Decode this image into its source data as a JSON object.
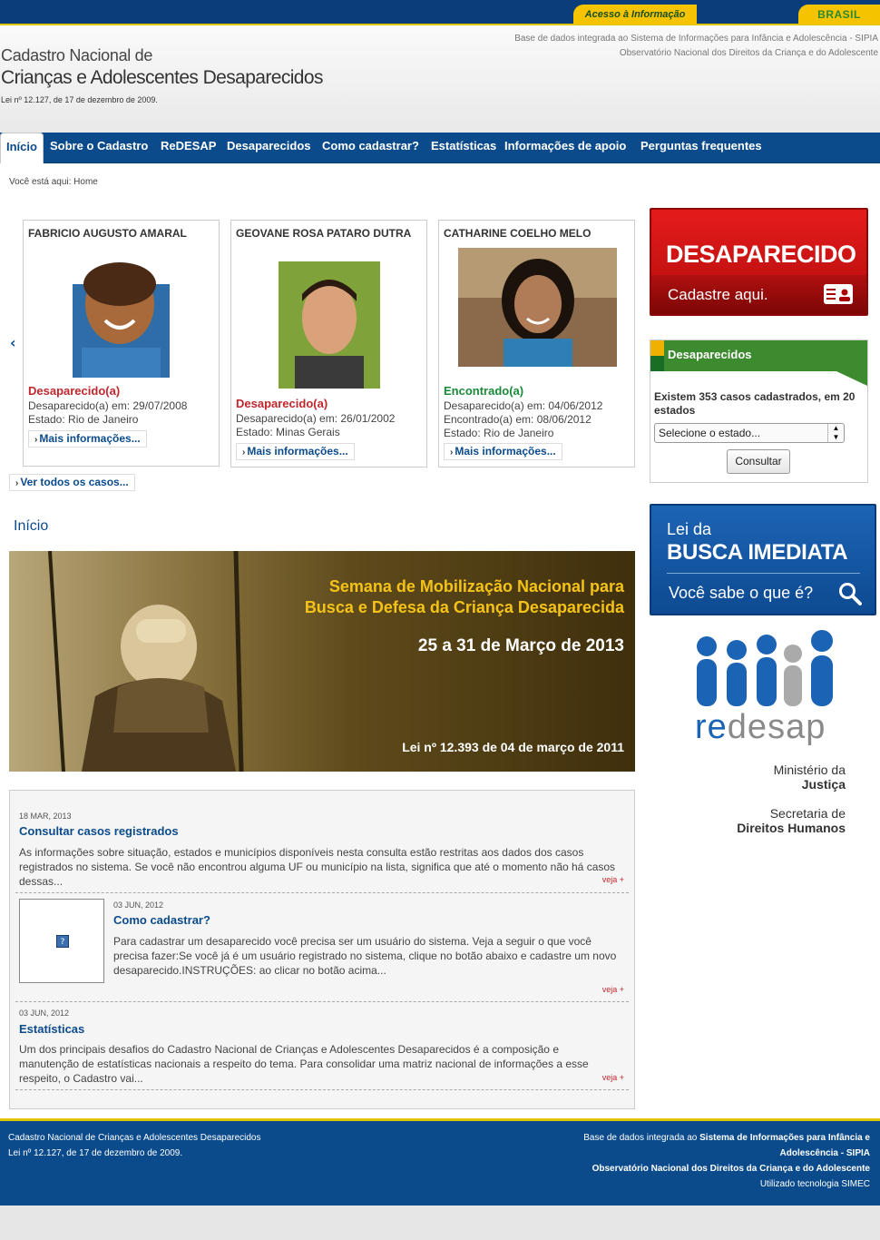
{
  "top_bar": {
    "acesso": "Acesso à Informação",
    "brasil": "BRASIL"
  },
  "header": {
    "title_line1": "Cadastro Nacional de",
    "title_line2": "Crianças e Adolescentes Desaparecidos",
    "law": "Lei nº 12.127, de 17 de dezembro de 2009.",
    "right_line1": "Base de dados integrada ao Sistema de Informações para Infância e Adolescência - SIPIA",
    "right_line2": "Observatório Nacional dos Direitos da Criança e do Adolescente"
  },
  "nav": {
    "items": [
      {
        "label": "Início"
      },
      {
        "label": "Sobre o Cadastro"
      },
      {
        "label": "ReDESAP"
      },
      {
        "label": "Desaparecidos"
      },
      {
        "label": "Como cadastrar?"
      },
      {
        "label": "Estatísticas"
      },
      {
        "label": "Informações de apoio"
      },
      {
        "label": "Perguntas frequentes"
      }
    ]
  },
  "breadcrumb": "Você está aqui: Home",
  "cases": [
    {
      "name": "FABRICIO AUGUSTO AMARAL",
      "status": "Desaparecido(a)",
      "line1": "Desaparecido(a) em: 29/07/2008",
      "line2": "Estado: Rio de Janeiro",
      "more": "Mais informações..."
    },
    {
      "name": "GEOVANE ROSA PATARO DUTRA",
      "status": "Desaparecido(a)",
      "line1": "Desaparecido(a) em: 26/01/2002",
      "line2": "Estado: Minas Gerais",
      "more": "Mais informações..."
    },
    {
      "name": "CATHARINE COELHO MELO",
      "status": "Encontrado(a)",
      "line1": "Desaparecido(a) em: 04/06/2012",
      "line2": "Encontrado(a) em: 08/06/2012",
      "line3": "Estado: Rio de Janeiro",
      "more": "Mais informações..."
    }
  ],
  "see_all": "Ver todos os casos...",
  "section_title": "Início",
  "banner": {
    "line1": "Semana de Mobilização Nacional para",
    "line2": "Busca e Defesa da Criança Desaparecida",
    "date": "25 a 31 de Março de 2013",
    "law": "Lei nº 12.393 de 04 de março de 2011"
  },
  "news": [
    {
      "date": "18 MAR, 2013",
      "title": "Consultar casos registrados",
      "body": "As informações sobre situação, estados e municípios disponíveis nesta consulta estão restritas aos dados dos casos registrados no sistema. Se você não encontrou alguma UF ou município na lista, significa que até o momento não há casos dessas...",
      "more": "veja +"
    },
    {
      "date": "03 JUN, 2012",
      "title": "Como cadastrar?",
      "body": "Para cadastrar um desaparecido você precisa ser um usuário do sistema. Veja a seguir o que você precisa fazer:Se você já é um usuário registrado no sistema, clique no botão abaixo e cadastre um novo desaparecido.INSTRUÇÕES: ao clicar no botão acima...",
      "more": "veja +"
    },
    {
      "date": "03 JUN, 2012",
      "title": "Estatísticas",
      "body": "Um dos principais desafios do Cadastro Nacional de Crianças e Adolescentes Desaparecidos é a composição e manutenção de estatísticas nacionais a respeito do tema. Para consolidar uma matriz nacional de informações a esse respeito, o Cadastro vai...",
      "more": "veja +"
    }
  ],
  "sidebar": {
    "promo_red": {
      "big": "DESAPARECIDO",
      "small": "Cadastre aqui."
    },
    "search": {
      "title": "Desaparecidos",
      "count": "Existem 353 casos cadastrados, em 20 estados",
      "select_value": "Selecione o estado...",
      "button": "Consultar"
    },
    "promo_blue": {
      "l1": "Lei da",
      "l2": "BUSCA IMEDIATA",
      "l3": "Você sabe o que é?"
    },
    "redesap": {
      "re": "re",
      "desap": "desap"
    },
    "ministerio": {
      "l1": "Ministério da",
      "l2": "Justiça"
    },
    "secretaria": {
      "l1": "Secretaria de",
      "l2": "Direitos Humanos"
    }
  },
  "footer": {
    "left1": "Cadastro Nacional de Crianças e Adolescentes Desaparecidos",
    "left2": "Lei nº 12.127, de 17 de dezembro de 2009.",
    "right_prefix": "Base de dados integrada ao",
    "right_bold1": "Sistema de Informações para Infância e",
    "right_bold2": "Adolescência - SIPIA",
    "right_bold3": "Observatório Nacional dos Direitos da Criança e do Adolescente",
    "right_small": "Utilizado tecnologia SIMEC"
  },
  "colors": {
    "nav_blue": "#0b4b8c",
    "gov_yellow": "#f5c300",
    "status_red": "#c0272d",
    "status_green": "#1a8a3a",
    "redesap_blue": "#1b63b5"
  }
}
